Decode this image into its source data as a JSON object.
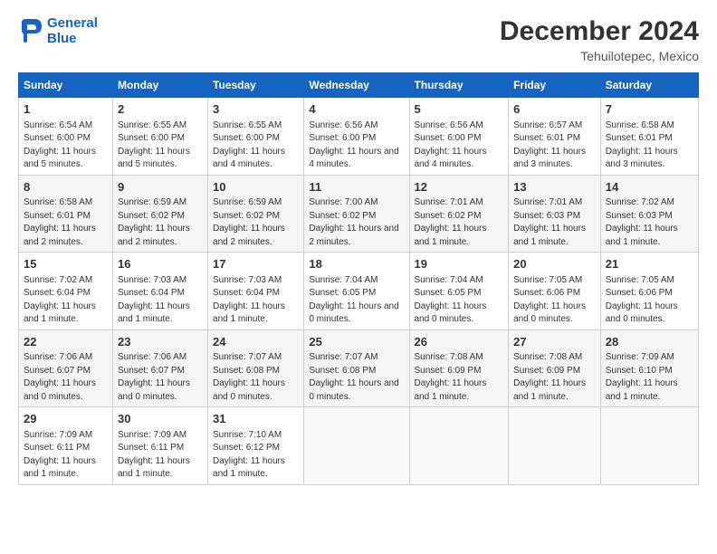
{
  "logo": {
    "line1": "General",
    "line2": "Blue"
  },
  "title": "December 2024",
  "subtitle": "Tehuilotepec, Mexico",
  "weekdays": [
    "Sunday",
    "Monday",
    "Tuesday",
    "Wednesday",
    "Thursday",
    "Friday",
    "Saturday"
  ],
  "weeks": [
    [
      {
        "day": 1,
        "rise": "6:54 AM",
        "set": "6:00 PM",
        "light": "11 hours and 5 minutes"
      },
      {
        "day": 2,
        "rise": "6:55 AM",
        "set": "6:00 PM",
        "light": "11 hours and 5 minutes"
      },
      {
        "day": 3,
        "rise": "6:55 AM",
        "set": "6:00 PM",
        "light": "11 hours and 4 minutes"
      },
      {
        "day": 4,
        "rise": "6:56 AM",
        "set": "6:00 PM",
        "light": "11 hours and 4 minutes"
      },
      {
        "day": 5,
        "rise": "6:56 AM",
        "set": "6:00 PM",
        "light": "11 hours and 4 minutes"
      },
      {
        "day": 6,
        "rise": "6:57 AM",
        "set": "6:01 PM",
        "light": "11 hours and 3 minutes"
      },
      {
        "day": 7,
        "rise": "6:58 AM",
        "set": "6:01 PM",
        "light": "11 hours and 3 minutes"
      }
    ],
    [
      {
        "day": 8,
        "rise": "6:58 AM",
        "set": "6:01 PM",
        "light": "11 hours and 2 minutes"
      },
      {
        "day": 9,
        "rise": "6:59 AM",
        "set": "6:02 PM",
        "light": "11 hours and 2 minutes"
      },
      {
        "day": 10,
        "rise": "6:59 AM",
        "set": "6:02 PM",
        "light": "11 hours and 2 minutes"
      },
      {
        "day": 11,
        "rise": "7:00 AM",
        "set": "6:02 PM",
        "light": "11 hours and 2 minutes"
      },
      {
        "day": 12,
        "rise": "7:01 AM",
        "set": "6:02 PM",
        "light": "11 hours and 1 minute"
      },
      {
        "day": 13,
        "rise": "7:01 AM",
        "set": "6:03 PM",
        "light": "11 hours and 1 minute"
      },
      {
        "day": 14,
        "rise": "7:02 AM",
        "set": "6:03 PM",
        "light": "11 hours and 1 minute"
      }
    ],
    [
      {
        "day": 15,
        "rise": "7:02 AM",
        "set": "6:04 PM",
        "light": "11 hours and 1 minute"
      },
      {
        "day": 16,
        "rise": "7:03 AM",
        "set": "6:04 PM",
        "light": "11 hours and 1 minute"
      },
      {
        "day": 17,
        "rise": "7:03 AM",
        "set": "6:04 PM",
        "light": "11 hours and 1 minute"
      },
      {
        "day": 18,
        "rise": "7:04 AM",
        "set": "6:05 PM",
        "light": "11 hours and 0 minutes"
      },
      {
        "day": 19,
        "rise": "7:04 AM",
        "set": "6:05 PM",
        "light": "11 hours and 0 minutes"
      },
      {
        "day": 20,
        "rise": "7:05 AM",
        "set": "6:06 PM",
        "light": "11 hours and 0 minutes"
      },
      {
        "day": 21,
        "rise": "7:05 AM",
        "set": "6:06 PM",
        "light": "11 hours and 0 minutes"
      }
    ],
    [
      {
        "day": 22,
        "rise": "7:06 AM",
        "set": "6:07 PM",
        "light": "11 hours and 0 minutes"
      },
      {
        "day": 23,
        "rise": "7:06 AM",
        "set": "6:07 PM",
        "light": "11 hours and 0 minutes"
      },
      {
        "day": 24,
        "rise": "7:07 AM",
        "set": "6:08 PM",
        "light": "11 hours and 0 minutes"
      },
      {
        "day": 25,
        "rise": "7:07 AM",
        "set": "6:08 PM",
        "light": "11 hours and 0 minutes"
      },
      {
        "day": 26,
        "rise": "7:08 AM",
        "set": "6:09 PM",
        "light": "11 hours and 1 minute"
      },
      {
        "day": 27,
        "rise": "7:08 AM",
        "set": "6:09 PM",
        "light": "11 hours and 1 minute"
      },
      {
        "day": 28,
        "rise": "7:09 AM",
        "set": "6:10 PM",
        "light": "11 hours and 1 minute"
      }
    ],
    [
      {
        "day": 29,
        "rise": "7:09 AM",
        "set": "6:11 PM",
        "light": "11 hours and 1 minute"
      },
      {
        "day": 30,
        "rise": "7:09 AM",
        "set": "6:11 PM",
        "light": "11 hours and 1 minute"
      },
      {
        "day": 31,
        "rise": "7:10 AM",
        "set": "6:12 PM",
        "light": "11 hours and 1 minute"
      },
      null,
      null,
      null,
      null
    ]
  ]
}
